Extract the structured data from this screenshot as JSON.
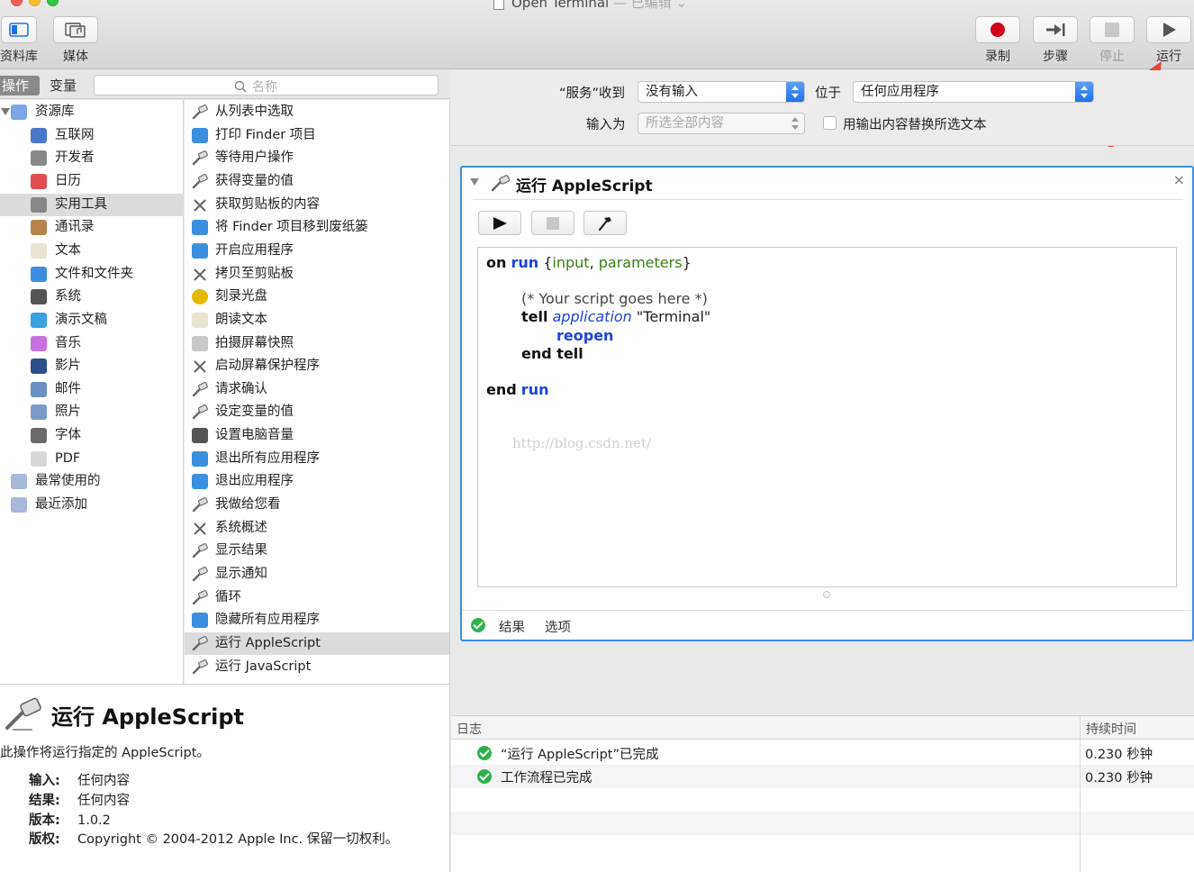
{
  "window": {
    "title": "Open Terminal",
    "status": " — 已编辑 ⌄"
  },
  "toolbar": {
    "library_label": "资料库",
    "media_label": "媒体",
    "record_label": "录制",
    "step_label": "步骤",
    "stop_label": "停止",
    "run_label": "运行"
  },
  "library": {
    "actions_tab": "操作",
    "variables_tab": "变量",
    "search_placeholder": "名称",
    "categories": [
      {
        "label": "资源库",
        "icon": "library-icon"
      },
      {
        "label": "互联网",
        "icon": "globe-icon"
      },
      {
        "label": "开发者",
        "icon": "tools-icon"
      },
      {
        "label": "日历",
        "icon": "calendar-icon"
      },
      {
        "label": "实用工具",
        "icon": "tools-icon"
      },
      {
        "label": "通讯录",
        "icon": "contacts-icon"
      },
      {
        "label": "文本",
        "icon": "text-icon"
      },
      {
        "label": "文件和文件夹",
        "icon": "finder-icon"
      },
      {
        "label": "系统",
        "icon": "system-icon"
      },
      {
        "label": "演示文稿",
        "icon": "presentation-icon"
      },
      {
        "label": "音乐",
        "icon": "music-icon"
      },
      {
        "label": "影片",
        "icon": "movie-icon"
      },
      {
        "label": "邮件",
        "icon": "mail-icon"
      },
      {
        "label": "照片",
        "icon": "photo-icon"
      },
      {
        "label": "字体",
        "icon": "font-icon"
      },
      {
        "label": "PDF",
        "icon": "pdf-icon"
      },
      {
        "label": "最常使用的",
        "icon": "smart-folder-icon"
      },
      {
        "label": "最近添加",
        "icon": "smart-folder-icon"
      }
    ],
    "actions": [
      {
        "label": "从列表中选取",
        "icon": "automator-icon"
      },
      {
        "label": "打印 Finder 项目",
        "icon": "finder-icon"
      },
      {
        "label": "等待用户操作",
        "icon": "automator-icon"
      },
      {
        "label": "获得变量的值",
        "icon": "automator-icon"
      },
      {
        "label": "获取剪贴板的内容",
        "icon": "tools-icon"
      },
      {
        "label": "将 Finder 项目移到废纸篓",
        "icon": "finder-icon"
      },
      {
        "label": "开启应用程序",
        "icon": "finder-icon"
      },
      {
        "label": "拷贝至剪贴板",
        "icon": "tools-icon"
      },
      {
        "label": "刻录光盘",
        "icon": "burn-icon"
      },
      {
        "label": "朗读文本",
        "icon": "text-icon"
      },
      {
        "label": "拍摄屏幕快照",
        "icon": "screenshot-icon"
      },
      {
        "label": "启动屏幕保护程序",
        "icon": "tools-icon"
      },
      {
        "label": "请求确认",
        "icon": "automator-icon"
      },
      {
        "label": "设定变量的值",
        "icon": "automator-icon"
      },
      {
        "label": "设置电脑音量",
        "icon": "system-icon"
      },
      {
        "label": "退出所有应用程序",
        "icon": "finder-icon"
      },
      {
        "label": "退出应用程序",
        "icon": "finder-icon"
      },
      {
        "label": "我做给您看",
        "icon": "automator-icon"
      },
      {
        "label": "系统概述",
        "icon": "tools-icon"
      },
      {
        "label": "显示结果",
        "icon": "automator-icon"
      },
      {
        "label": "显示通知",
        "icon": "automator-icon"
      },
      {
        "label": "循环",
        "icon": "automator-icon"
      },
      {
        "label": "隐藏所有应用程序",
        "icon": "finder-icon"
      },
      {
        "label": "运行 AppleScript",
        "icon": "automator-icon"
      },
      {
        "label": "运行 JavaScript",
        "icon": "automator-icon"
      }
    ]
  },
  "description": {
    "title": "运行 AppleScript",
    "summary": "此操作将运行指定的 AppleScript。",
    "input_key": "输入:",
    "input_val": "任何内容",
    "result_key": "结果:",
    "result_val": "任何内容",
    "version_key": "版本:",
    "version_val": "1.0.2",
    "copyright_key": "版权:",
    "copyright_val": "Copyright © 2004-2012 Apple Inc.  保留一切权利。"
  },
  "workflow": {
    "service_receives_label": "“服务”收到",
    "service_receives_value": "没有输入",
    "in_label": "位于",
    "in_value": "任何应用程序",
    "input_is_label": "输入为",
    "input_is_value": "所选全部内容",
    "replace_label": "用输出内容替换所选文本"
  },
  "action_card": {
    "title": "运行 AppleScript",
    "close": "×",
    "code": {
      "l1_on": "on",
      "l1_run": "run",
      "l1_args_open": " {",
      "l1_input": "input",
      "l1_comma": ", ",
      "l1_params": "parameters",
      "l1_close": "}",
      "l2_comment": "(* Your script goes here *)",
      "l3_tell": "tell",
      "l3_app": "application",
      "l3_str": " \"Terminal\"",
      "l4_reopen": "reopen",
      "l5_end": "end tell",
      "l6_end": "end",
      "l6_run": "run"
    },
    "watermark": "http://blog.csdn.net/",
    "results_label": "结果",
    "options_label": "选项"
  },
  "log": {
    "col_log": "日志",
    "col_duration": "持续时间",
    "rows": [
      {
        "message": "“运行 AppleScript”已完成",
        "duration": "0.230 秒钟"
      },
      {
        "message": "工作流程已完成",
        "duration": "0.230 秒钟"
      }
    ]
  },
  "colors": {
    "accent": "#3b8fde",
    "record": "#d0021b",
    "success": "#2fb24c",
    "annotation": "#e8452c"
  }
}
